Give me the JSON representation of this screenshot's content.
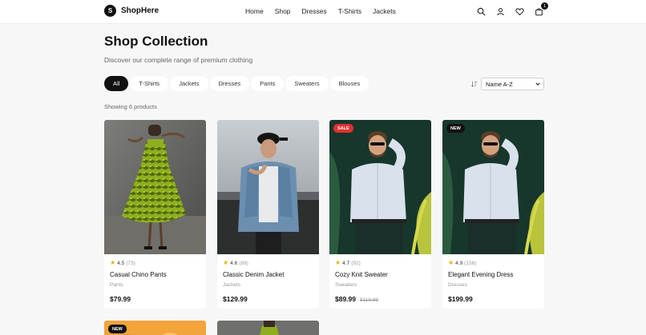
{
  "brand": {
    "logo_letter": "S",
    "name": "ShopHere"
  },
  "nav": [
    "Home",
    "Shop",
    "Dresses",
    "T-Shirts",
    "Jackets"
  ],
  "header_icons": [
    "search-icon",
    "user-icon",
    "heart-icon",
    "bag-icon"
  ],
  "cart_count": "1",
  "page": {
    "title": "Shop Collection",
    "subtitle": "Discover our complete range of premium clothing"
  },
  "filters": [
    "All",
    "T-Shirts",
    "Jackets",
    "Dresses",
    "Pants",
    "Sweaters",
    "Blouses"
  ],
  "active_filter": "All",
  "sort": {
    "selected": "Name A-Z"
  },
  "results": {
    "count_text": "Showing 6 products"
  },
  "products": [
    {
      "name": "Casual Chino Pants",
      "category": "Pants",
      "rating": "4.5",
      "reviews": "(73)",
      "price": "$79.99",
      "old_price": "",
      "tag": ""
    },
    {
      "name": "Classic Denim Jacket",
      "category": "Jackets",
      "rating": "4.6",
      "reviews": "(89)",
      "price": "$129.99",
      "old_price": "",
      "tag": ""
    },
    {
      "name": "Cozy Knit Sweater",
      "category": "Sweaters",
      "rating": "4.7",
      "reviews": "(92)",
      "price": "$89.99",
      "old_price": "$119.99",
      "tag": "SALE"
    },
    {
      "name": "Elegant Evening Dress",
      "category": "Dresses",
      "rating": "4.9",
      "reviews": "(156)",
      "price": "$199.99",
      "old_price": "",
      "tag": "NEW"
    }
  ],
  "partial_products": [
    {
      "tag": "NEW"
    },
    {
      "tag": ""
    }
  ],
  "colors": {
    "accent": "#111111",
    "sale": "#e03131",
    "star": "#f5b301",
    "background": "#f7f7f7"
  }
}
